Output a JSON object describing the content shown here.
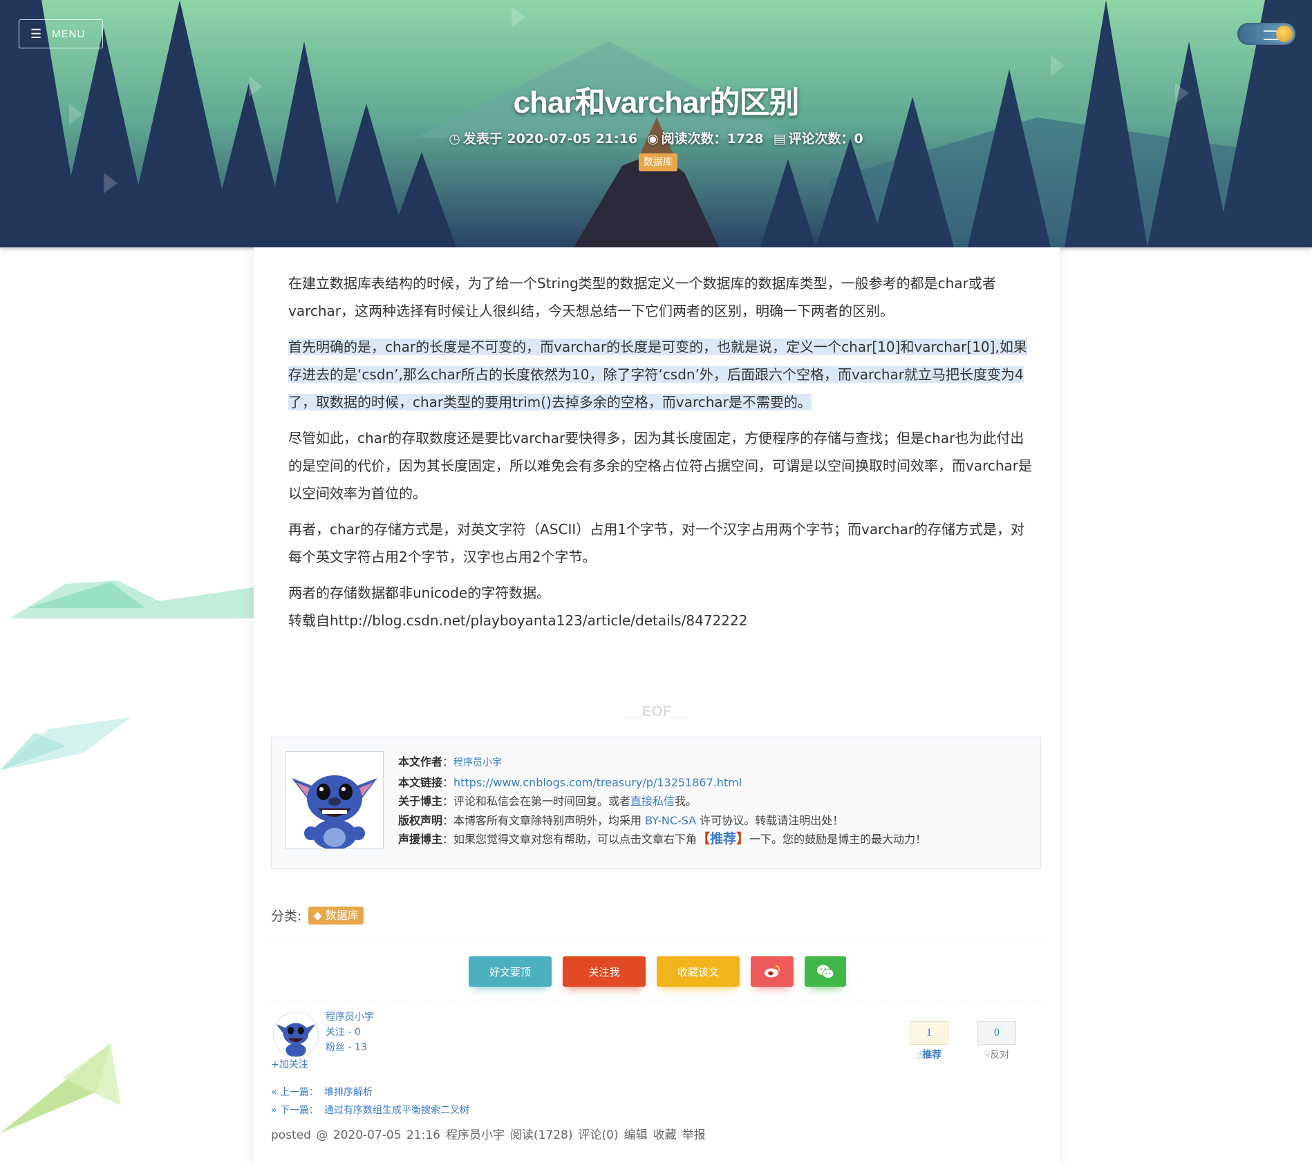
{
  "header": {
    "menu_label": "MENU",
    "title": "char和varchar的区别",
    "meta": {
      "posted_label": "发表于 2020-07-05 21:16",
      "reads_label": "阅读次数：1728",
      "comments_label": "评论次数：0"
    },
    "category_tag": "数据库"
  },
  "article": {
    "p1": "在建立数据库表结构的时候，为了给一个String类型的数据定义一个数据库的数据库类型，一般参考的都是char或者varchar，这两种选择有时候让人很纠结，今天想总结一下它们两者的区别，明确一下两者的区别。",
    "p2": "首先明确的是，char的长度是不可变的，而varchar的长度是可变的，也就是说，定义一个char[10]和varchar[10],如果存进去的是‘csdn’,那么char所占的长度依然为10，除了字符‘csdn’外，后面跟六个空格，而varchar就立马把长度变为4了，取数据的时候，char类型的要用trim()去掉多余的空格，而varchar是不需要的。",
    "p3": "尽管如此，char的存取数度还是要比varchar要快得多，因为其长度固定，方便程序的存储与查找；但是char也为此付出的是空间的代价，因为其长度固定，所以难免会有多余的空格占位符占据空间，可谓是以空间换取时间效率，而varchar是以空间效率为首位的。",
    "p4": "再者，char的存储方式是，对英文字符（ASCII）占用1个字节，对一个汉字占用两个字节；而varchar的存储方式是，对每个英文字符占用2个字节，汉字也占用2个字节。",
    "p5": "两者的存储数据都非unicode的字符数据。",
    "p6": "转载自http://blog.csdn.net/playboyanta123/article/details/8472222"
  },
  "eof": "__EOF__",
  "author_box": {
    "author_label": "本文作者",
    "author_name": "程序员小宇",
    "link_label": "本文链接",
    "link_url": "https://www.cnblogs.com/treasury/p/13251867.html",
    "about_label": "关于博主",
    "about_text_1": "评论和私信会在第一时间回复。或者",
    "about_link": "直接私信",
    "about_text_2": "我。",
    "copyright_label": "版权声明",
    "copyright_text_1": "本博客所有文章除特别声明外，均采用 ",
    "copyright_link": "BY-NC-SA",
    "copyright_text_2": " 许可协议。转载请注明出处！",
    "support_label": "声援博主",
    "support_text_1": "如果您觉得文章对您有帮助，可以点击文章右下角",
    "support_open": "【",
    "support_word": "推荐",
    "support_close": "】",
    "support_text_2": "一下。您的鼓励是博主的最大动力！",
    "colon": "："
  },
  "category": {
    "label": "分类:",
    "tag": "数据库"
  },
  "share_buttons": {
    "good_post": "好文要顶",
    "follow_me": "关注我",
    "favorite": "收藏该文"
  },
  "blogger": {
    "name": "程序员小宇",
    "following": "关注 - 0",
    "followers": "粉丝 - 13",
    "add_follow": "+加关注"
  },
  "votes": {
    "digg_count": "1",
    "digg_label": "推荐",
    "bury_count": "0",
    "bury_label": "反对"
  },
  "nav": {
    "prev_label": "« 上一篇：",
    "prev_title": "堆排序解析",
    "next_label": "» 下一篇：",
    "next_title": "通过有序数组生成平衡搜索二叉树"
  },
  "postdesc": {
    "posted": "posted @ 2020-07-05 21:16",
    "author": "程序员小宇",
    "reads": "阅读(1728)",
    "comments": "评论(0)",
    "edit": "编辑",
    "collect": "收藏",
    "report": "举报"
  }
}
